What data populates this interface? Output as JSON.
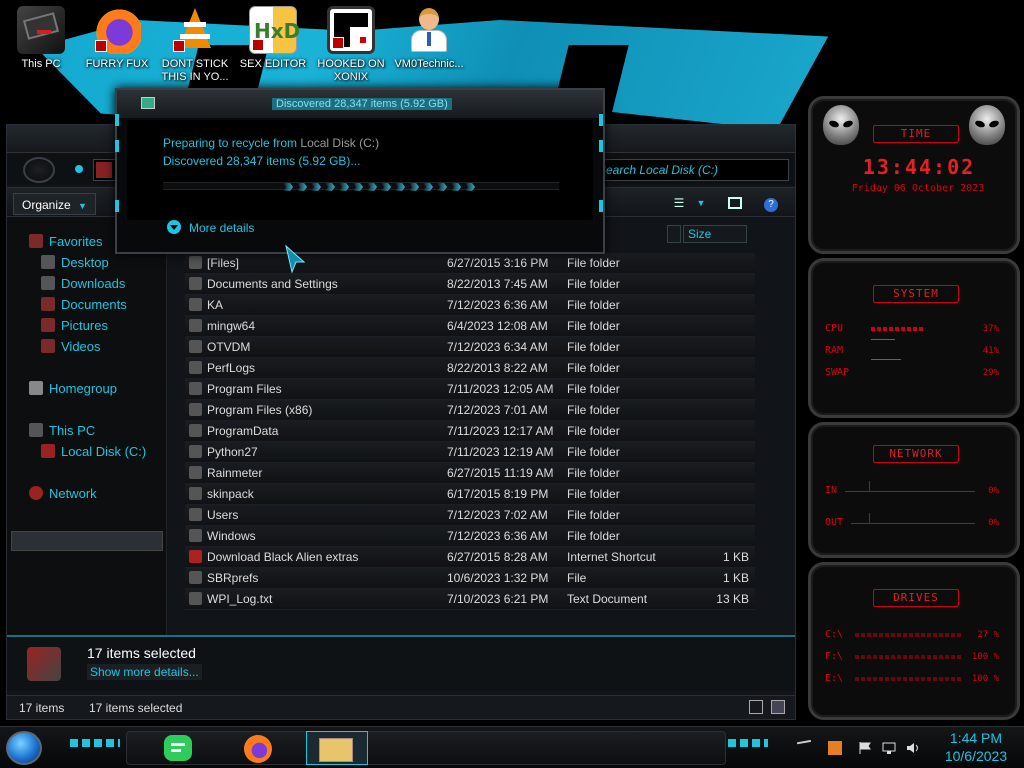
{
  "desktop": {
    "icons": [
      {
        "label": "This PC"
      },
      {
        "label": "FURRY FUX"
      },
      {
        "label": "DONT STICK THIS IN YO..."
      },
      {
        "label": "SEX EDITOR"
      },
      {
        "label": "HOOKED ON XONIX"
      },
      {
        "label": "VM0Technic..."
      }
    ]
  },
  "explorer": {
    "search_placeholder": "Search Local Disk (C:)",
    "toolbar": {
      "organize": "Organize"
    },
    "column_size": "Size",
    "nav": {
      "favorites": "Favorites",
      "desktop": "Desktop",
      "downloads": "Downloads",
      "documents": "Documents",
      "pictures": "Pictures",
      "videos": "Videos",
      "homegroup": "Homegroup",
      "this_pc": "This PC",
      "local_disk": "Local Disk (C:)",
      "network": "Network"
    },
    "files": [
      {
        "name": "[Files]",
        "date": "6/27/2015 3:16 PM",
        "type": "File folder",
        "size": ""
      },
      {
        "name": "Documents and Settings",
        "date": "8/22/2013 7:45 AM",
        "type": "File folder",
        "size": ""
      },
      {
        "name": "KA",
        "date": "7/12/2023 6:36 AM",
        "type": "File folder",
        "size": ""
      },
      {
        "name": "mingw64",
        "date": "6/4/2023 12:08 AM",
        "type": "File folder",
        "size": ""
      },
      {
        "name": "OTVDM",
        "date": "7/12/2023 6:34 AM",
        "type": "File folder",
        "size": ""
      },
      {
        "name": "PerfLogs",
        "date": "8/22/2013 8:22 AM",
        "type": "File folder",
        "size": ""
      },
      {
        "name": "Program Files",
        "date": "7/11/2023 12:05 AM",
        "type": "File folder",
        "size": ""
      },
      {
        "name": "Program Files (x86)",
        "date": "7/12/2023 7:01 AM",
        "type": "File folder",
        "size": ""
      },
      {
        "name": "ProgramData",
        "date": "7/11/2023 12:17 AM",
        "type": "File folder",
        "size": ""
      },
      {
        "name": "Python27",
        "date": "7/11/2023 12:19 AM",
        "type": "File folder",
        "size": ""
      },
      {
        "name": "Rainmeter",
        "date": "6/27/2015 11:19 AM",
        "type": "File folder",
        "size": ""
      },
      {
        "name": "skinpack",
        "date": "6/17/2015 8:19 PM",
        "type": "File folder",
        "size": ""
      },
      {
        "name": "Users",
        "date": "7/12/2023 7:02 AM",
        "type": "File folder",
        "size": ""
      },
      {
        "name": "Windows",
        "date": "7/12/2023 6:36 AM",
        "type": "File folder",
        "size": ""
      },
      {
        "name": "Download Black Alien extras",
        "date": "6/27/2015 8:28 AM",
        "type": "Internet Shortcut",
        "size": "1 KB"
      },
      {
        "name": "SBRprefs",
        "date": "10/6/2023 1:32 PM",
        "type": "File",
        "size": "1 KB"
      },
      {
        "name": "WPI_Log.txt",
        "date": "7/10/2023 6:21 PM",
        "type": "Text Document",
        "size": "13 KB"
      }
    ],
    "details": {
      "title": "17 items selected",
      "link": "Show more details..."
    },
    "status": {
      "count": "17 items",
      "selected": "17 items selected"
    }
  },
  "dialog": {
    "title": "Discovered 28,347 items (5.92 GB)",
    "line1_prefix": "Preparing to recycle from ",
    "line1_source": "Local Disk (C:)",
    "line2": "Discovered 28,347 items (5.92 GB)...",
    "more_details": "More details",
    "progress": 0.78
  },
  "gadgets": {
    "time": {
      "title": "TIME",
      "clock": "13:44:02",
      "date": "Friday 06 October 2023"
    },
    "system": {
      "title": "SYSTEM",
      "rows": [
        {
          "label": "CPU",
          "value": "37%"
        },
        {
          "label": "RAM",
          "value": "41%"
        },
        {
          "label": "SWAP",
          "value": "29%"
        }
      ]
    },
    "network": {
      "title": "NETWORK",
      "rows": [
        {
          "label": "IN",
          "value": "0%"
        },
        {
          "label": "OUT",
          "value": "0%"
        }
      ]
    },
    "drives": {
      "title": "DRIVES",
      "rows": [
        {
          "label": "C:\\",
          "value": "27 %"
        },
        {
          "label": "F:\\",
          "value": "100 %"
        },
        {
          "label": "E:\\",
          "value": "100 %"
        }
      ]
    }
  },
  "taskbar": {
    "time": "1:44 PM",
    "date": "10/6/2023"
  },
  "colors": {
    "accent": "#1fc4e0",
    "gadget_red": "#e02020"
  }
}
